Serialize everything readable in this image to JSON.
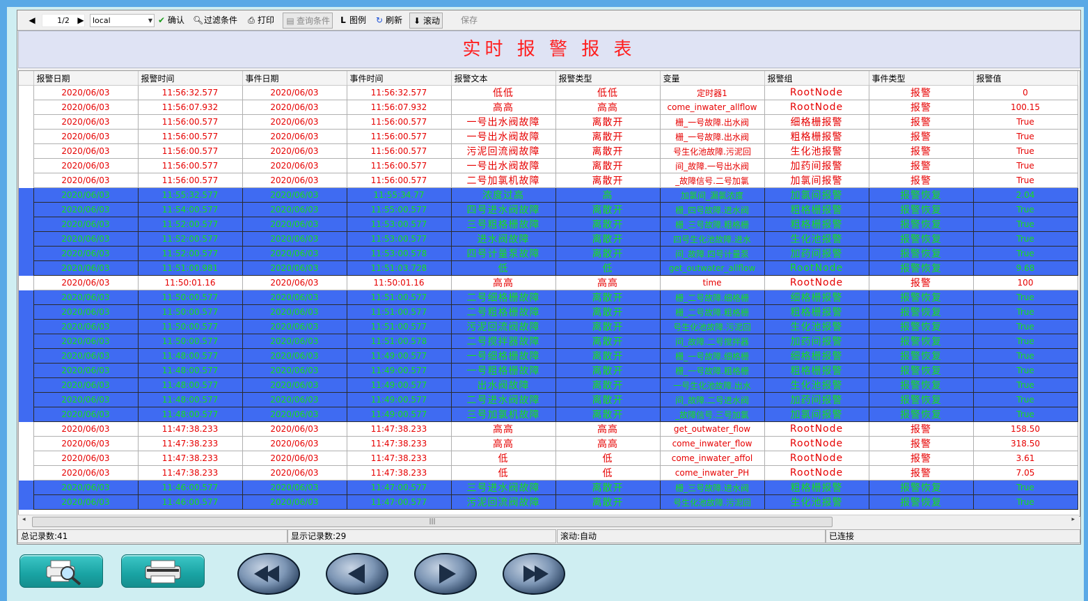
{
  "toolbar": {
    "page": "1/2",
    "source": "local",
    "confirm": "确认",
    "filter": "过滤条件",
    "print": "打印",
    "query": "查询条件",
    "legend": "图例",
    "refresh": "刷新",
    "scroll": "滚动",
    "save": "保存"
  },
  "title": "实时 报 警 报 表",
  "columns": [
    "报警日期",
    "报警时间",
    "事件日期",
    "事件时间",
    "报警文本",
    "报警类型",
    "变量",
    "报警组",
    "事件类型",
    "报警值"
  ],
  "rows": [
    {
      "t": "alarm",
      "c": [
        "2020/06/03",
        "11:56:32.577",
        "2020/06/03",
        "11:56:32.577",
        "低低",
        "低低",
        "定时器1",
        "RootNode",
        "报警",
        "0"
      ]
    },
    {
      "t": "alarm",
      "c": [
        "2020/06/03",
        "11:56:07.932",
        "2020/06/03",
        "11:56:07.932",
        "高高",
        "高高",
        "come_inwater_allflow",
        "RootNode",
        "报警",
        "100.15"
      ]
    },
    {
      "t": "alarm",
      "c": [
        "2020/06/03",
        "11:56:00.577",
        "2020/06/03",
        "11:56:00.577",
        "一号出水阀故障",
        "离散开",
        "栅_一号故障.出水阀",
        "细格栅报警",
        "报警",
        "True"
      ]
    },
    {
      "t": "alarm",
      "c": [
        "2020/06/03",
        "11:56:00.577",
        "2020/06/03",
        "11:56:00.577",
        "一号出水阀故障",
        "离散开",
        "栅_一号故障.出水阀",
        "粗格栅报警",
        "报警",
        "True"
      ]
    },
    {
      "t": "alarm",
      "c": [
        "2020/06/03",
        "11:56:00.577",
        "2020/06/03",
        "11:56:00.577",
        "污泥回流阀故障",
        "离散开",
        "号生化池故障.污泥回",
        "生化池报警",
        "报警",
        "True"
      ]
    },
    {
      "t": "alarm",
      "c": [
        "2020/06/03",
        "11:56:00.577",
        "2020/06/03",
        "11:56:00.577",
        "一号出水阀故障",
        "离散开",
        "间_故障.一号出水阀",
        "加药间报警",
        "报警",
        "True"
      ]
    },
    {
      "t": "alarm",
      "c": [
        "2020/06/03",
        "11:56:00.577",
        "2020/06/03",
        "11:56:00.577",
        "二号加氯机故障",
        "离散开",
        "_故障信号.二号加氯",
        "加氯间报警",
        "报警",
        "True"
      ]
    },
    {
      "t": "recover",
      "c": [
        "2020/06/03",
        "11:55:32.577",
        "2020/06/03",
        "11:55:34.77",
        "浓度过高",
        "高",
        "加氯间_漏氯浓度",
        "加氯间报警",
        "报警恢复",
        "2.04"
      ]
    },
    {
      "t": "recover",
      "c": [
        "2020/06/03",
        "11:54:00.577",
        "2020/06/03",
        "11:55:00.577",
        "四号进水阀故障",
        "离散开",
        "栅_四号故障.进水阀",
        "粗格栅报警",
        "报警恢复",
        "True"
      ]
    },
    {
      "t": "recover",
      "c": [
        "2020/06/03",
        "11:52:00.577",
        "2020/06/03",
        "11:53:00.577",
        "三号粗格栅故障",
        "离散开",
        "栅_三号故障.粗格栅",
        "粗格栅报警",
        "报警恢复",
        "True"
      ]
    },
    {
      "t": "recover",
      "c": [
        "2020/06/03",
        "11:52:00.577",
        "2020/06/03",
        "11:53:00.577",
        "进水阀故障",
        "离散开",
        "四号生化池故障.进水",
        "生化池报警",
        "报警恢复",
        "True"
      ]
    },
    {
      "t": "recover",
      "c": [
        "2020/06/03",
        "11:52:00.577",
        "2020/06/03",
        "11:53:00.578",
        "四号计量泵故障",
        "离散开",
        "间_故障.四号计量泵",
        "加药间报警",
        "报警恢复",
        "True"
      ]
    },
    {
      "t": "recover",
      "c": [
        "2020/06/03",
        "11:51:00.981",
        "2020/06/03",
        "11:51:03.728",
        "低",
        "低",
        "get_outwater_allflow",
        "RootNode",
        "报警恢复",
        "9.68"
      ]
    },
    {
      "t": "alarm",
      "c": [
        "2020/06/03",
        "11:50:01.16",
        "2020/06/03",
        "11:50:01.16",
        "高高",
        "高高",
        "time",
        "RootNode",
        "报警",
        "100"
      ]
    },
    {
      "t": "recover",
      "c": [
        "2020/06/03",
        "11:50:00.577",
        "2020/06/03",
        "11:51:00.577",
        "二号细格栅故障",
        "离散开",
        "栅_二号故障.细格栅",
        "细格栅报警",
        "报警恢复",
        "True"
      ]
    },
    {
      "t": "recover",
      "c": [
        "2020/06/03",
        "11:50:00.577",
        "2020/06/03",
        "11:51:00.577",
        "二号粗格栅故障",
        "离散开",
        "栅_二号故障.粗格栅",
        "粗格栅报警",
        "报警恢复",
        "True"
      ]
    },
    {
      "t": "recover",
      "c": [
        "2020/06/03",
        "11:50:00.577",
        "2020/06/03",
        "11:51:00.577",
        "污泥回流阀故障",
        "离散开",
        "号生化池故障.污泥回",
        "生化池报警",
        "报警恢复",
        "True"
      ]
    },
    {
      "t": "recover",
      "c": [
        "2020/06/03",
        "11:50:00.577",
        "2020/06/03",
        "11:51:00.578",
        "二号搅拌器故障",
        "离散开",
        "间_故障.二号搅拌器",
        "加药间报警",
        "报警恢复",
        "True"
      ]
    },
    {
      "t": "recover",
      "c": [
        "2020/06/03",
        "11:48:00.577",
        "2020/06/03",
        "11:49:00.577",
        "一号细格栅故障",
        "离散开",
        "栅_一号故障.细格栅",
        "细格栅报警",
        "报警恢复",
        "True"
      ]
    },
    {
      "t": "recover",
      "c": [
        "2020/06/03",
        "11:48:00.577",
        "2020/06/03",
        "11:49:00.577",
        "一号粗格栅故障",
        "离散开",
        "栅_一号故障.粗格栅",
        "粗格栅报警",
        "报警恢复",
        "True"
      ]
    },
    {
      "t": "recover",
      "c": [
        "2020/06/03",
        "11:48:00.577",
        "2020/06/03",
        "11:49:00.577",
        "出水阀故障",
        "离散开",
        "一号生化池故障.出水",
        "生化池报警",
        "报警恢复",
        "True"
      ]
    },
    {
      "t": "recover",
      "c": [
        "2020/06/03",
        "11:48:00.577",
        "2020/06/03",
        "11:49:00.577",
        "二号进水阀故障",
        "离散开",
        "间_故障.二号进水阀",
        "加药间报警",
        "报警恢复",
        "True"
      ]
    },
    {
      "t": "recover",
      "c": [
        "2020/06/03",
        "11:48:00.577",
        "2020/06/03",
        "11:49:00.577",
        "三号加氯机故障",
        "离散开",
        "_故障信号.三号加氯",
        "加氯间报警",
        "报警恢复",
        "True"
      ]
    },
    {
      "t": "alarm",
      "c": [
        "2020/06/03",
        "11:47:38.233",
        "2020/06/03",
        "11:47:38.233",
        "高高",
        "高高",
        "get_outwater_flow",
        "RootNode",
        "报警",
        "158.50"
      ]
    },
    {
      "t": "alarm",
      "c": [
        "2020/06/03",
        "11:47:38.233",
        "2020/06/03",
        "11:47:38.233",
        "高高",
        "高高",
        "come_inwater_flow",
        "RootNode",
        "报警",
        "318.50"
      ]
    },
    {
      "t": "alarm",
      "c": [
        "2020/06/03",
        "11:47:38.233",
        "2020/06/03",
        "11:47:38.233",
        "低",
        "低",
        "come_inwater_affol",
        "RootNode",
        "报警",
        "3.61"
      ]
    },
    {
      "t": "alarm",
      "c": [
        "2020/06/03",
        "11:47:38.233",
        "2020/06/03",
        "11:47:38.233",
        "低",
        "低",
        "come_inwater_PH",
        "RootNode",
        "报警",
        "7.05"
      ]
    },
    {
      "t": "recover",
      "c": [
        "2020/06/03",
        "11:46:00.577",
        "2020/06/03",
        "11:47:00.577",
        "三号进水阀故障",
        "离散开",
        "栅_三号故障.进水阀",
        "粗格栅报警",
        "报警恢复",
        "True"
      ]
    },
    {
      "t": "recover",
      "c": [
        "2020/06/03",
        "11:46:00.577",
        "2020/06/03",
        "11:47:00.577",
        "污泥回流阀故障",
        "离散开",
        "号生化池故障.污泥回",
        "生化池报警",
        "报警恢复",
        "True"
      ]
    }
  ],
  "status": {
    "total": "总记录数:41",
    "shown": "显示记录数:29",
    "scroll": "滚动:自动",
    "conn": "已连接"
  },
  "colors": {
    "alarm_text": "#e60000",
    "recover_bg": "#3f6bf2",
    "recover_text": "#18e018",
    "title": "#ff1e1e"
  }
}
